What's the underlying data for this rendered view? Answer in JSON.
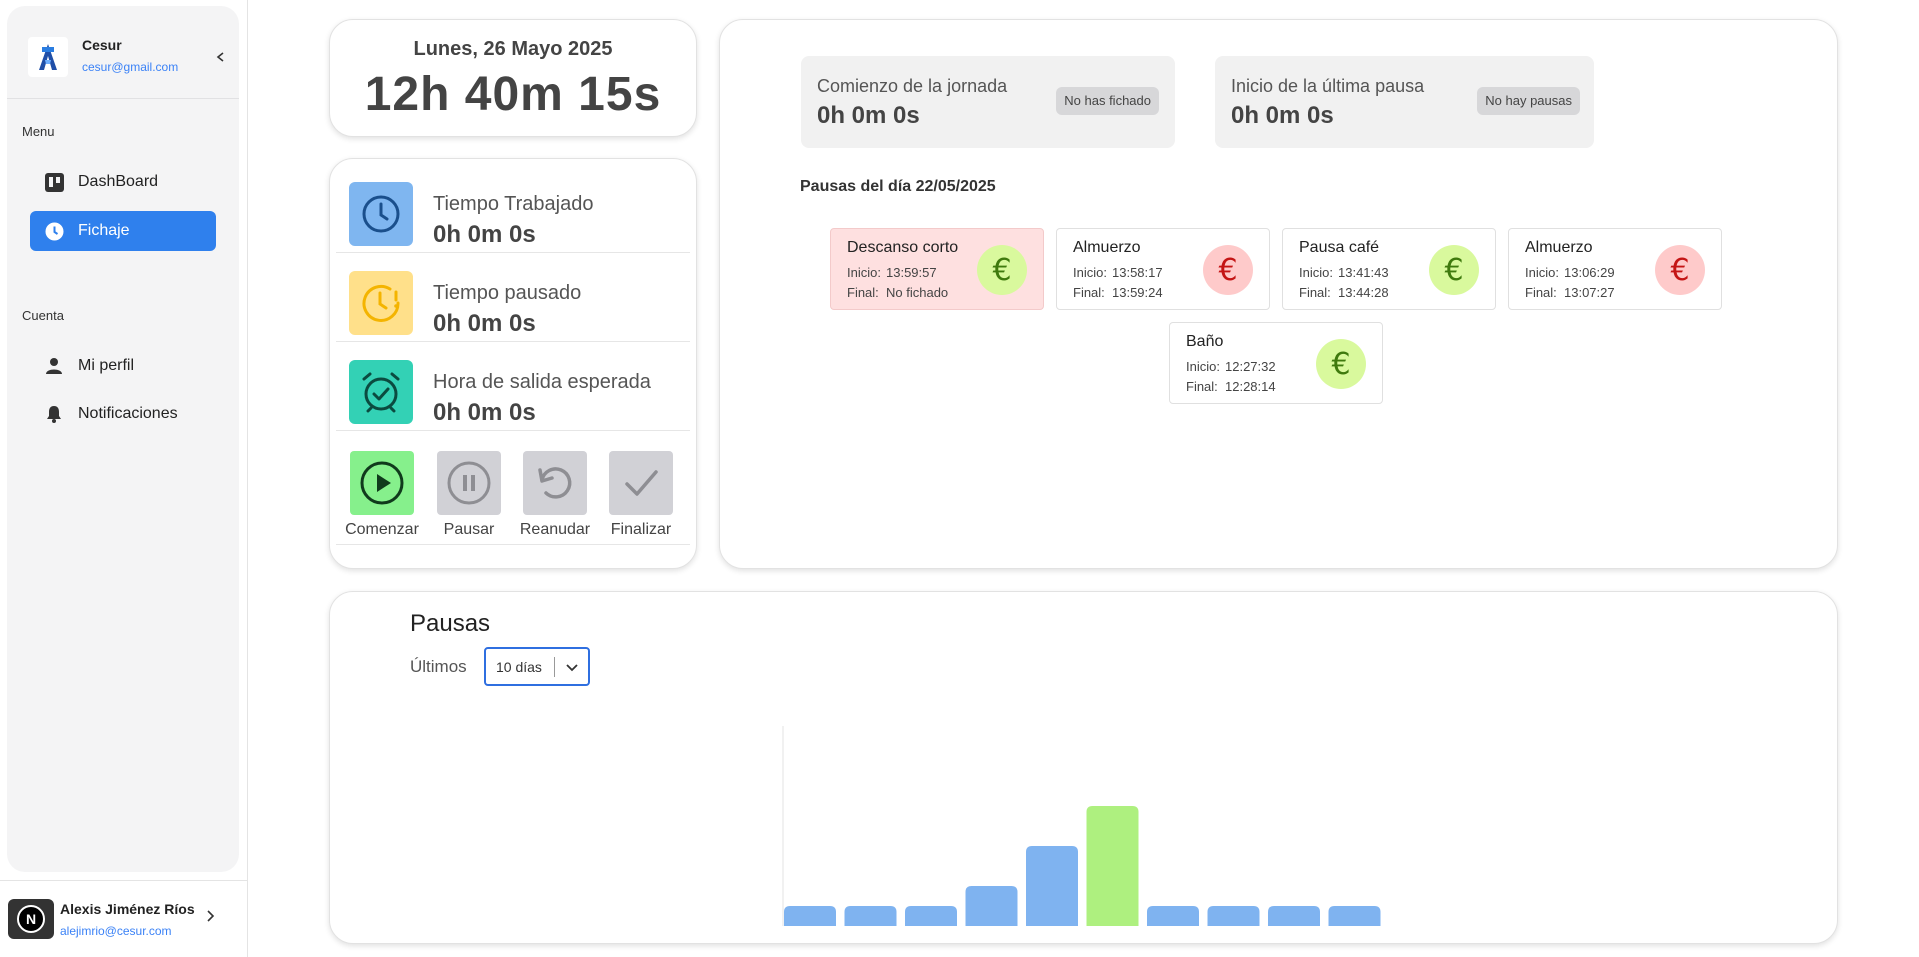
{
  "sidebar": {
    "org_name": "Cesur",
    "org_email": "cesur@gmail.com",
    "sections": {
      "menu": "Menu",
      "account": "Cuenta"
    },
    "items": [
      {
        "label": "DashBoard",
        "icon": "board-icon",
        "active": false
      },
      {
        "label": "Fichaje",
        "icon": "clock-icon",
        "active": true
      },
      {
        "label": "Mi perfil",
        "icon": "user-icon",
        "active": false
      },
      {
        "label": "Notificaciones",
        "icon": "bell-icon",
        "active": false
      }
    ],
    "user": {
      "initial": "N",
      "name": "Alexis Jiménez Ríos",
      "email": "alejimrio@cesur.com"
    }
  },
  "clock": {
    "date": "Lunes, 26 Mayo 2025",
    "time": "12h 40m 15s"
  },
  "stats": [
    {
      "label": "Tiempo Trabajado",
      "value": "0h 0m 0s",
      "icon": "clock-icon",
      "color": "#7fb6f0"
    },
    {
      "label": "Tiempo pausado",
      "value": "0h 0m 0s",
      "icon": "clock-alert-icon",
      "color": "#ffe08a"
    },
    {
      "label": "Hora de salida esperada",
      "value": "0h 0m 0s",
      "icon": "alarm-check-icon",
      "color": "#33d1b5"
    }
  ],
  "actions": [
    {
      "label": "Comenzar",
      "icon": "play-icon",
      "enabled": true
    },
    {
      "label": "Pausar",
      "icon": "pause-icon",
      "enabled": false
    },
    {
      "label": "Reanudar",
      "icon": "rotate-ccw-icon",
      "enabled": false
    },
    {
      "label": "Finalizar",
      "icon": "check-icon",
      "enabled": false
    }
  ],
  "jornada": {
    "start_label": "Comienzo de la jornada",
    "start_value": "0h 0m 0s",
    "start_chip": "No has fichado",
    "pause_label": "Inicio de la última pausa",
    "pause_value": "0h 0m 0s",
    "pause_chip": "No hay pausas"
  },
  "pauses_day": {
    "title": "Pausas del día 22/05/2025",
    "start_key": "Inicio:",
    "end_key": "Final:",
    "items": [
      {
        "title": "Descanso corto",
        "start": "13:59:57",
        "end": "No fichado",
        "paid": true,
        "highlight": true
      },
      {
        "title": "Almuerzo",
        "start": "13:58:17",
        "end": "13:59:24",
        "paid": false,
        "highlight": false
      },
      {
        "title": "Pausa café",
        "start": "13:41:43",
        "end": "13:44:28",
        "paid": true,
        "highlight": false
      },
      {
        "title": "Almuerzo",
        "start": "13:06:29",
        "end": "13:07:27",
        "paid": false,
        "highlight": false
      },
      {
        "title": "Baño",
        "start": "12:27:32",
        "end": "12:28:14",
        "paid": true,
        "highlight": false
      }
    ],
    "euro_symbol": "€"
  },
  "colors": {
    "accent": "#2f80ed",
    "paid_bg": "#d9f99d",
    "paid_fg": "#3f7a0e",
    "unpaid_bg": "#fecaca",
    "unpaid_fg": "#c41515",
    "bar_default": "#7fb3f0",
    "bar_highlight": "#aef07f"
  },
  "pauses_chart": {
    "title": "Pausas",
    "range_label": "Últimos",
    "range_value": "10 días"
  },
  "chart_data": {
    "type": "bar",
    "title": "Pausas",
    "categories": [
      "",
      "",
      "",
      "",
      "",
      "",
      "",
      "",
      "",
      ""
    ],
    "values": [
      1,
      1,
      1,
      2,
      4,
      6,
      1,
      1,
      1,
      1
    ],
    "highlight_index": 5,
    "ylim": [
      0,
      10
    ],
    "grid": false
  }
}
